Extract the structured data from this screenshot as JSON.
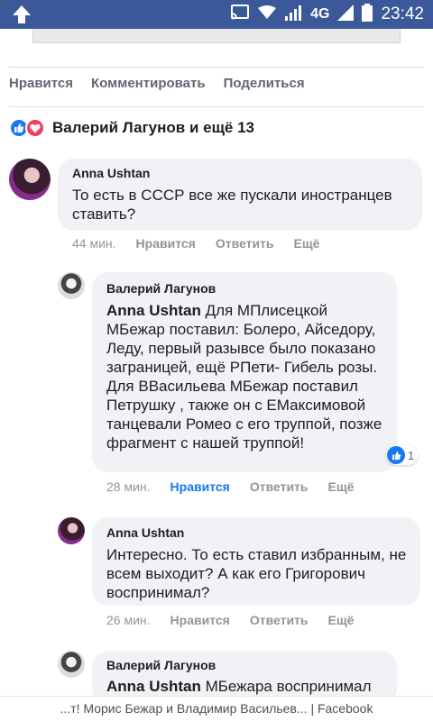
{
  "status_bar": {
    "network": "4G",
    "time": "23:42",
    "icons": [
      "arrow-up-icon",
      "cast-icon",
      "wifi-icon",
      "signal-icon",
      "battery-icon"
    ]
  },
  "post_actions": {
    "like": "Нравится",
    "comment": "Комментировать",
    "share": "Поделиться"
  },
  "reactions": {
    "summary": "Валерий Лагунов и ещё 13",
    "icons": [
      "like-icon",
      "love-icon"
    ]
  },
  "comments": [
    {
      "author": "Anna Ushtan",
      "text": "То есть в СССР все же пускали иностранцев ставить?",
      "time": "44 мин.",
      "like": "Нравится",
      "reply": "Ответить",
      "more": "Ещё"
    },
    {
      "author": "Валерий Лагунов",
      "mention": "Anna Ushtan",
      "text": " Для МПлисецкой МБежар поставил: Болеро, Айседору, Леду, первый разывсе было показано заграницей, ещё РПети- Гибель розы.\nДля ВВасильева МБежар поставил Петрушку , также он с ЕМаксимовой танцевали Ромео с его труппой, позже фрагмент с нашей труппой!",
      "reaction_count": "1",
      "time": "28 мин.",
      "like": "Нравится",
      "reply": "Ответить",
      "more": "Ещё"
    },
    {
      "author": "Anna Ushtan",
      "text": "Интересно. То есть ставил избранным, не всем выходит? А как его Григорович воспринимал?",
      "time": "26 мин.",
      "like": "Нравится",
      "reply": "Ответить",
      "more": "Ещё"
    },
    {
      "author": "Валерий Лагунов",
      "mention": "Anna Ushtan",
      "text": " МБежара воспринимал"
    }
  ],
  "footer": {
    "title": "...т! Морис Бежар и Владимир Васильев... | Facebook"
  },
  "colors": {
    "status_bar": "#3b5998",
    "like_blue": "#1877f2",
    "love_red": "#f33e58",
    "bubble_bg": "#f0f2f5",
    "meta_gray": "#90949c"
  }
}
